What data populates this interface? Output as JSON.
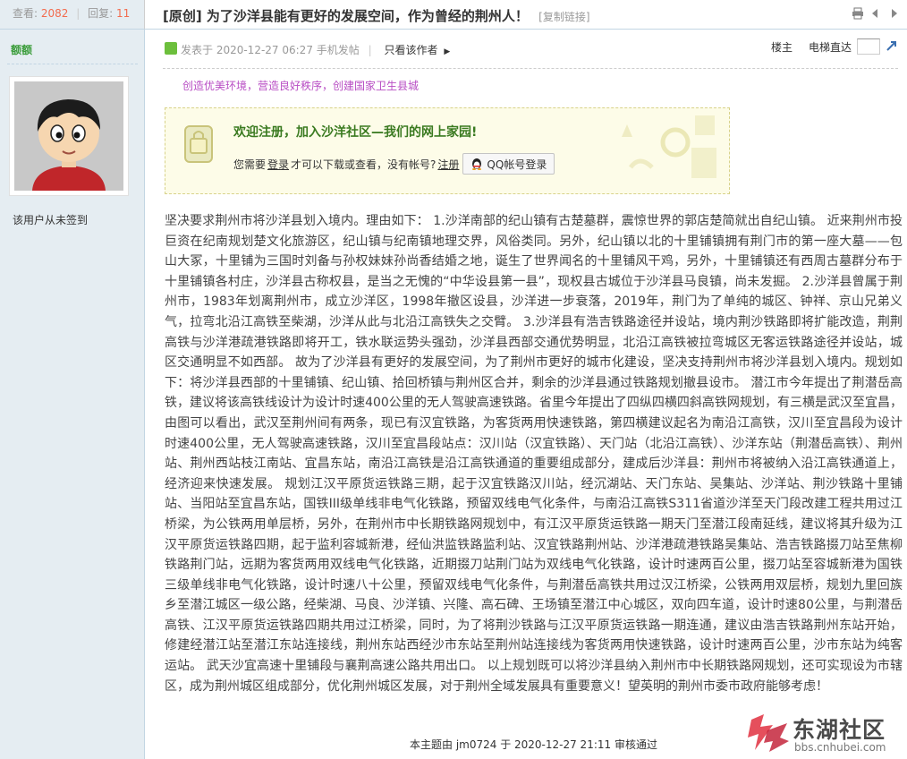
{
  "stats": {
    "views_label": "查看:",
    "views": "2082",
    "replies_label": "回复:",
    "replies": "11"
  },
  "thread": {
    "title": "[原创] 为了沙洋县能有更好的发展空间，作为曾经的荆州人！",
    "copy_link": "[复制链接]"
  },
  "author": {
    "name": "额额",
    "signin_note": "该用户从未签到"
  },
  "post": {
    "posted": "发表于 2020-12-27 06:27",
    "device": "手机发帖",
    "author_only": "只看该作者",
    "floor": "楼主",
    "jump_label": "电梯直达"
  },
  "slogan": "创造优美环境，营造良好秩序，创建国家卫生县城",
  "notice": {
    "title": "欢迎注册，加入沙洋社区—我们的网上家园!",
    "text_before": "您需要",
    "login_link": "登录",
    "text_middle": "才可以下载或查看，没有帐号?",
    "register_link": "注册",
    "qq_button": "QQ帐号登录"
  },
  "article": "坚决要求荆州市将沙洋县划入境内。理由如下： 1.沙洋南部的纪山镇有古楚墓群，震惊世界的郭店楚简就出自纪山镇。 近来荆州市投巨资在纪南规划楚文化旅游区，纪山镇与纪南镇地理交界，风俗类同。另外，纪山镇以北的十里铺镇拥有荆门市的第一座大墓——包山大冢，十里铺为三国时刘备与孙权妹妹孙尚香结婚之地，诞生了世界闻名的十里铺风干鸡，另外，十里铺镇还有西周古墓群分布于十里铺镇各村庄，沙洋县古称权县，是当之无愧的“中华设县第一县”，现权县古城位于沙洋县马良镇，尚未发掘。 2.沙洋县曾属于荆州市，1983年划离荆州市，成立沙洋区，1998年撤区设县，沙洋进一步衰落，2019年，荆门为了单纯的城区、钟祥、京山兄弟义气，拉弯北沿江高铁至柴湖，沙洋从此与北沿江高铁失之交臂。 3.沙洋县有浩吉铁路途径并设站，境内荆沙铁路即将扩能改造，荆荆高铁与沙洋港疏港铁路即将开工，铁水联运势头强劲，沙洋县西部交通优势明显，北沿江高铁被拉弯城区无客运铁路途径并设站，城区交通明显不如西部。 故为了沙洋县有更好的发展空间，为了荆州市更好的城市化建设，坚决支持荆州市将沙洋县划入境内。规划如下：将沙洋县西部的十里铺镇、纪山镇、拾回桥镇与荆州区合并，剩余的沙洋县通过铁路规划撤县设市。 潜江市今年提出了荆潜岳高铁，建议将该高铁线设计为设计时速400公里的无人驾驶高速铁路。省里今年提出了四纵四横四斜高铁网规划，有三横是武汉至宜昌，由图可以看出，武汉至荆州间有两条，现已有汉宜铁路，为客货两用快速铁路，第四横建议起名为南沿江高铁，汉川至宜昌段为设计时速400公里，无人驾驶高速铁路，汉川至宜昌段站点：汉川站（汉宜铁路）、天门站（北沿江高铁）、沙洋东站（荆潜岳高铁）、荆州站、荆州西站枝江南站、宜昌东站，南沿江高铁是沿江高铁通道的重要组成部分，建成后沙洋县：荆州市将被纳入沿江高铁通道上，经济迎来快速发展。 规划江汉平原货运铁路三期，起于汉宜铁路汉川站，经沉湖站、天门东站、吴集站、沙洋站、荆沙铁路十里铺站、当阳站至宜昌东站，国铁III级单线非电气化铁路，预留双线电气化条件，与南沿江高铁S311省道沙洋至天门段改建工程共用过江桥梁，为公铁两用单层桥，另外，在荆州市中长期铁路网规划中，有江汉平原货运铁路一期天门至潜江段南延线，建议将其升级为江汉平原货运铁路四期，起于监利容城新港，经仙洪监铁路监利站、汉宜铁路荆州站、沙洋港疏港铁路吴集站、浩吉铁路掇刀站至焦柳铁路荆门站，远期为客货两用双线电气化铁路，近期掇刀站荆门站为双线电气化铁路，设计时速两百公里，掇刀站至容城新港为国铁三级单线非电气化铁路，设计时速八十公里，预留双线电气化条件，与荆潜岳高铁共用过汉江桥梁，公铁两用双层桥，规划九里回族乡至潜江城区一级公路，经柴湖、马良、沙洋镇、兴隆、高石碑、王场镇至潜江中心城区，双向四车道，设计时速80公里，与荆潜岳高铁、江汉平原货运铁路四期共用过江桥梁，同时，为了将荆沙铁路与江汉平原货运铁路一期连通，建议由浩吉铁路荆州东站开始，修建经潜江站至潜江东站连接线，荆州东站西经沙市东站至荆州站连接线为客货两用快速铁路，设计时速两百公里，沙市东站为纯客运站。 武天沙宜高速十里铺段与襄荆高速公路共用出口。 以上规划既可以将沙洋县纳入荆州市中长期铁路网规划，还可实现设为市辖区，成为荆州城区组成部分，优化荆州城区发展，对于荆州全域发展具有重要意义！望英明的荆州市委市政府能够考虑！",
  "approval": "本主题由 jm0724 于 2020-12-27 21:11 审核通过",
  "watermark": {
    "name": "东湖社区",
    "url": "bbs.cnhubei.com"
  },
  "icons": {
    "title_tools": [
      "print-icon",
      "previous-icon",
      "next-icon"
    ],
    "post": "post-icon",
    "jump": "go-icon",
    "notice": "lock-icon",
    "qq": "qq-penguin-icon"
  },
  "colors": {
    "sidebar_bg": "#e5edf2",
    "accent_red": "#f26c4f",
    "author_green": "#3a9c3a",
    "slogan_purple": "#b84dc4",
    "notice_bg": "#fdfce8",
    "notice_title": "#3a7a20"
  }
}
